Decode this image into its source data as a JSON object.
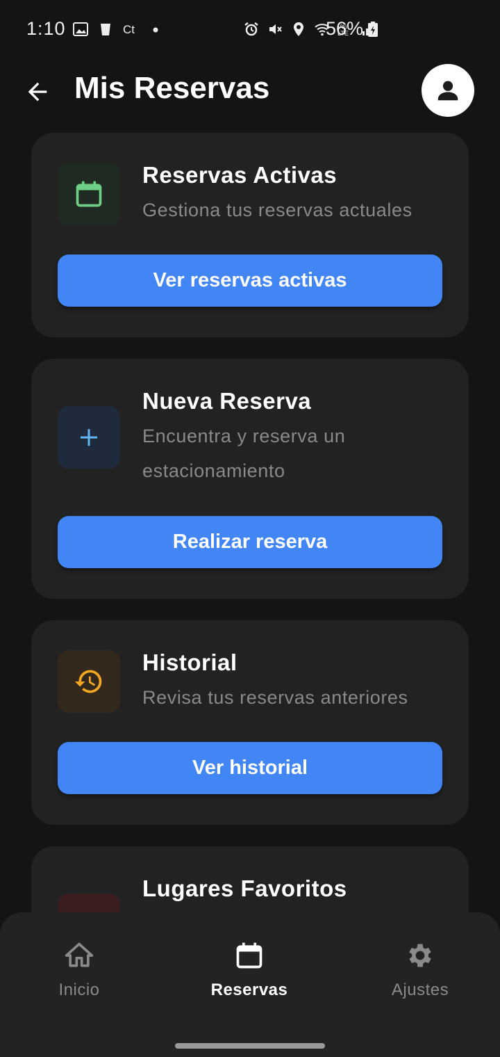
{
  "status": {
    "time": "1:10",
    "battery": "56%",
    "icons": [
      "image-icon",
      "cup-icon",
      "ct-icon",
      "dot-icon",
      "alarm-icon",
      "mute-icon",
      "location-icon",
      "wifi-icon",
      "volte-icon",
      "signal-icon",
      "battery-icon"
    ]
  },
  "header": {
    "title": "Mis Reservas",
    "back_icon": "arrow-left-icon",
    "avatar_icon": "person-icon"
  },
  "cards": [
    {
      "title": "Reservas Activas",
      "description": "Gestiona tus reservas actuales",
      "button": "Ver reservas activas",
      "icon": "calendar-icon",
      "icon_color": "#6fcf87",
      "icon_bg": "#1f2b22"
    },
    {
      "title": "Nueva Reserva",
      "description": "Encuentra y reserva un estacionamiento",
      "button": "Realizar reserva",
      "icon": "plus-icon",
      "icon_color": "#64b5f6",
      "icon_bg": "#1f2b3d"
    },
    {
      "title": "Historial",
      "description": "Revisa tus reservas anteriores",
      "button": "Ver historial",
      "icon": "history-icon",
      "icon_color": "#f5a623",
      "icon_bg": "#33281c"
    },
    {
      "title": "Lugares Favoritos",
      "icon": "favorite-icon",
      "icon_bg": "#3a1d1f"
    }
  ],
  "nav": {
    "items": [
      {
        "label": "Inicio",
        "icon": "home-icon"
      },
      {
        "label": "Reservas",
        "icon": "calendar-icon",
        "active": true
      },
      {
        "label": "Ajustes",
        "icon": "gear-icon"
      }
    ]
  },
  "colors": {
    "background": "#141414",
    "card": "#222223",
    "accent": "#4285f4",
    "nav": "#232323"
  }
}
